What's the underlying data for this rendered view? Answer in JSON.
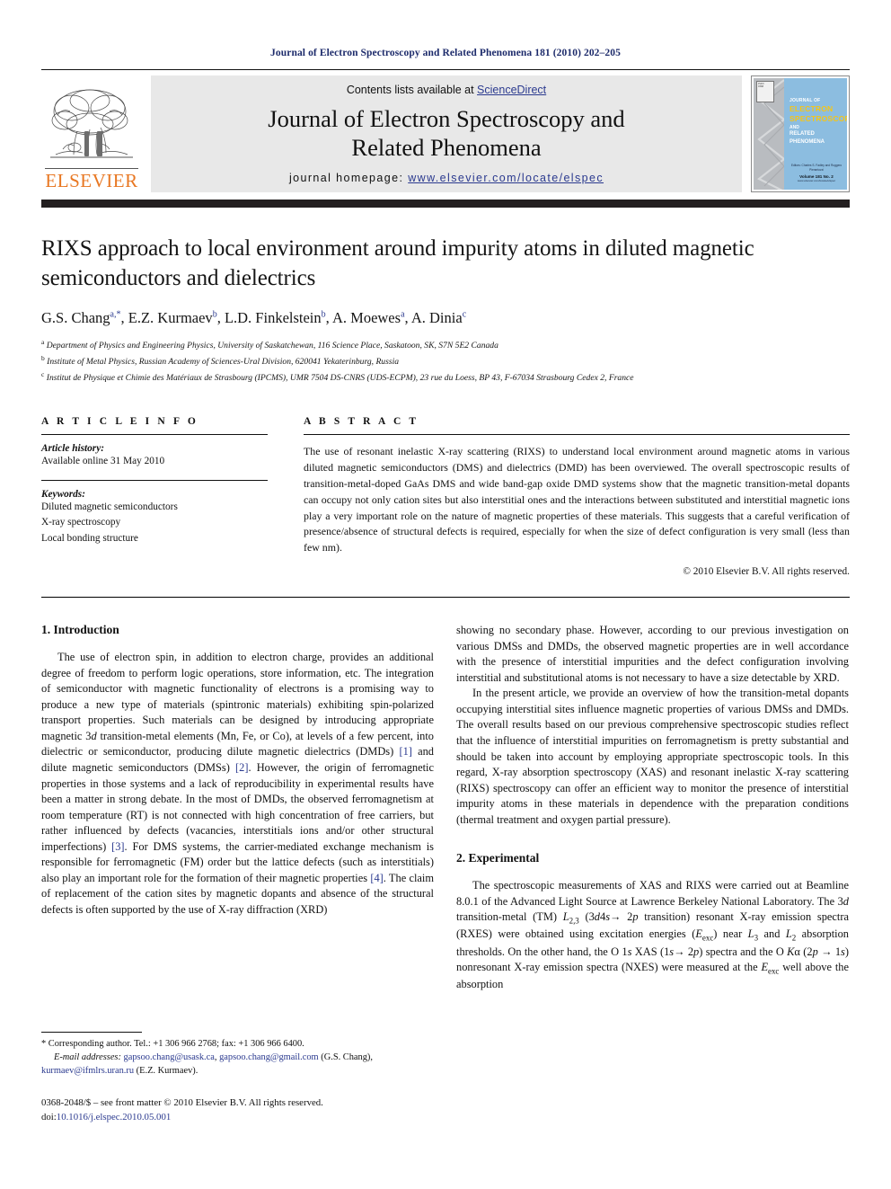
{
  "running_head": "Journal of Electron Spectroscopy and Related Phenomena 181 (2010) 202–205",
  "masthead": {
    "contents_prefix": "Contents lists available at ",
    "sciencedirect": "ScienceDirect",
    "journal_title_line1": "Journal of Electron Spectroscopy and",
    "journal_title_line2": "Related Phenomena",
    "homepage_prefix": "journal homepage: ",
    "homepage_url": "www.elsevier.com/locate/elspec",
    "publisher_wordmark": "ELSEVIER",
    "cover": {
      "line1": "JOURNAL OF",
      "line2": "ELECTRON",
      "line3": "SPECTROSCOPY",
      "line4": "AND",
      "line5": "RELATED PHENOMENA",
      "foot1": "Editors: Charles S. Fadley and Ruggero Pierantozzi",
      "foot2": "Volume 181 No. 2",
      "foot3": "www.elsevier.com/locate/elspec"
    },
    "accent_link_color": "#2b3a8f",
    "elsevier_orange": "#E87722",
    "band_gray": "#e8e8e8"
  },
  "article": {
    "title": "RIXS approach to local environment around impurity atoms in diluted magnetic semiconductors and dielectrics",
    "authors_html": "G.S. Chang<sup>a,*</sup>, E.Z. Kurmaev<sup>b</sup>, L.D. Finkelstein<sup>b</sup>, A. Moewes<sup>a</sup>, A. Dinia<sup>c</sup>",
    "affiliations": [
      "Department of Physics and Engineering Physics, University of Saskatchewan, 116 Science Place, Saskatoon, SK, S7N 5E2 Canada",
      "Institute of Metal Physics, Russian Academy of Sciences-Ural Division, 620041 Yekaterinburg, Russia",
      "Institut de Physique et Chimie des Matériaux de Strasbourg (IPCMS), UMR 7504 DS-CNRS (UDS-ECPM), 23 rue du Loess, BP 43, F-67034 Strasbourg Cedex 2, France"
    ],
    "affiliation_marks": [
      "a",
      "b",
      "c"
    ]
  },
  "article_info": {
    "heading": "A R T I C L E    I N F O",
    "history_label": "Article history:",
    "history_value": "Available online 31 May 2010",
    "keywords_label": "Keywords:",
    "keywords": [
      "Diluted magnetic semiconductors",
      "X-ray spectroscopy",
      "Local bonding structure"
    ]
  },
  "abstract": {
    "heading": "A B S T R A C T",
    "text": "The use of resonant inelastic X-ray scattering (RIXS) to understand local environment around magnetic atoms in various diluted magnetic semiconductors (DMS) and dielectrics (DMD) has been overviewed. The overall spectroscopic results of transition-metal-doped GaAs DMS and wide band-gap oxide DMD systems show that the magnetic transition-metal dopants can occupy not only cation sites but also interstitial ones and the interactions between substituted and interstitial magnetic ions play a very important role on the nature of magnetic properties of these materials. This suggests that a careful verification of presence/absence of structural defects is required, especially for when the size of defect configuration is very small (less than few nm).",
    "copyright": "© 2010 Elsevier B.V. All rights reserved."
  },
  "sections": {
    "introduction_heading": "1.  Introduction",
    "experimental_heading": "2.  Experimental"
  },
  "body": {
    "left_par1_html": "The use of electron spin, in addition to electron charge, provides an additional degree of freedom to perform logic operations, store information, etc. The integration of semiconductor with magnetic functionality of electrons is a promising way to produce a new type of materials (spintronic materials) exhibiting spin-polarized transport properties. Such materials can be designed by introducing appropriate magnetic 3<span class=\"ital\">d</span> transition-metal elements (Mn, Fe, or Co), at levels of a few percent, into dielectric or semiconductor, producing dilute magnetic dielectrics (DMDs) <span class=\"ref\">[1]</span> and dilute magnetic semiconductors (DMSs) <span class=\"ref\">[2]</span>. However, the origin of ferromagnetic properties in those systems and a lack of reproducibility in experimental results have been a matter in strong debate. In the most of DMDs, the observed ferromagnetism at room temperature (RT) is not connected with high concentration of free carriers, but rather influenced by defects (vacancies, interstitials ions and/or other structural imperfections) <span class=\"ref\">[3]</span>. For DMS systems, the carrier-mediated exchange mechanism is responsible for ferromagnetic (FM) order but the lattice defects (such as interstitials) also play an important role for the formation of their magnetic properties <span class=\"ref\">[4]</span>. The claim of replacement of the cation sites by magnetic dopants and absence of the structural defects is often supported by the use of X-ray diffraction (XRD)",
    "right_par1_html": "showing no secondary phase. However, according to our previous investigation on various DMSs and DMDs, the observed magnetic properties are in well accordance with the presence of interstitial impurities and the defect configuration involving interstitial and substitutional atoms is not necessary to have a size detectable by XRD.",
    "right_par2_html": "In the present article, we provide an overview of how the transition-metal dopants occupying interstitial sites influence magnetic properties of various DMSs and DMDs. The overall results based on our previous comprehensive spectroscopic studies reflect that the influence of interstitial impurities on ferromagnetism is pretty substantial and should be taken into account by employing appropriate spectroscopic tools. In this regard, X-ray absorption spectroscopy (XAS) and resonant inelastic X-ray scattering (RIXS) spectroscopy can offer an efficient way to monitor the presence of interstitial impurity atoms in these materials in dependence with the preparation conditions (thermal treatment and oxygen partial pressure).",
    "right_par3_html": "The spectroscopic measurements of XAS and RIXS were carried out at Beamline 8.0.1 of the Advanced Light Source at Lawrence Berkeley National Laboratory. The 3<span class=\"ital\">d</span> transition-metal (TM) <span class=\"ital\">L</span><sub>2,3</sub> (3<span class=\"ital\">d</span>4<span class=\"ital\">s</span>→ 2<span class=\"ital\">p</span> transition) resonant X-ray emission spectra (RXES) were obtained using excitation energies (<span class=\"ital\">E</span><sub>exc</sub>) near <span class=\"ital\">L</span><sub>3</sub> and <span class=\"ital\">L</span><sub>2</sub> absorption thresholds. On the other hand, the O 1<span class=\"ital\">s</span> XAS (1<span class=\"ital\">s</span>→ 2<span class=\"ital\">p</span>) spectra and the O <span class=\"ital\">K</span>α (2<span class=\"ital\">p</span> → 1<span class=\"ital\">s</span>) nonresonant X-ray emission spectra (NXES) were measured at the <span class=\"ital\">E</span><sub>exc</sub> well above the absorption"
  },
  "footnotes": {
    "corresponding_html": "* Corresponding author. Tel.: +1 306 966 2768; fax: +1 306 966 6400.",
    "email_html": "<span class=\"em\">E-mail addresses:</span> <span class=\"lnk\">gapsoo.chang@usask.ca</span>, <span class=\"lnk\">gapsoo.chang@gmail.com</span> (G.S. Chang), <span class=\"lnk\">kurmaev@ifmlrs.uran.ru</span> (E.Z. Kurmaev).",
    "issn_html": "0368-2048/$ – see front matter © 2010 Elsevier B.V. All rights reserved.",
    "doi_html": "doi:<span class=\"doi\">10.1016/j.elspec.2010.05.001</span>"
  }
}
